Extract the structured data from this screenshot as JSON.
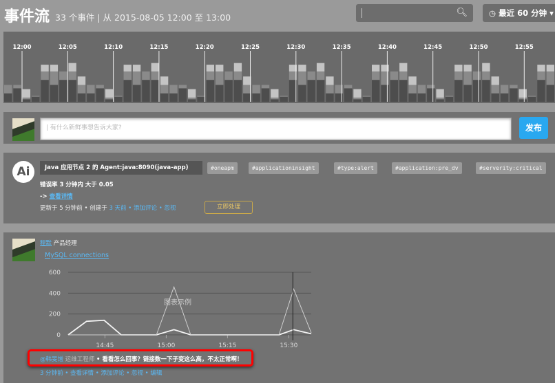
{
  "header": {
    "title": "事件流",
    "subtitle": "33 个事件 | 从 2015-08-05 12:00 至 13:00",
    "search_placeholder": "",
    "search_icon": "search-icon",
    "time_range": "最近 60 分钟"
  },
  "timeline": {
    "labels": [
      "12:00",
      "12:05",
      "12:10",
      "12:15",
      "12:20",
      "12:25",
      "12:30",
      "12:35",
      "12:40",
      "12:45",
      "12:50",
      "12:55"
    ],
    "bar_pattern": [
      [
        5,
        5,
        0
      ],
      [
        8,
        2,
        0
      ],
      [
        1.5,
        1,
        5
      ],
      [
        3,
        0.5,
        0
      ],
      [
        13,
        5,
        4
      ],
      [
        10,
        8,
        4
      ],
      [
        13,
        5,
        0
      ],
      [
        13,
        5,
        5
      ],
      [
        5,
        5,
        5
      ]
    ],
    "bar_count": 60,
    "colors": [
      "#4d4d4d",
      "#8a8a8a",
      "#c4c4c4"
    ]
  },
  "composer": {
    "placeholder": "有什么新鲜事想告诉大家?",
    "publish": "发布"
  },
  "alert": {
    "avatar": "Ai",
    "title": "Java 应用节点 2 的 Agent:java:8090(java-app)",
    "tags": [
      "#oneapm",
      "#applicationinsight",
      "#type:alert",
      "#application:pre_dv",
      "#serverity:critical"
    ],
    "message": "错误率 3 分钟内 大于 0.05",
    "arrow": "->",
    "details": "查看详情",
    "meta_prefix": "更新于 5 分钟前 • 创建于",
    "meta_created": "3 天前",
    "meta_comment": "添加评论",
    "meta_ignore": "忽视",
    "sep": "•",
    "handle": "立即处理"
  },
  "post": {
    "author": "程默",
    "role": "产品经理",
    "chart_link": "MySQL connections",
    "comment_user": "@韩旻馐",
    "comment_role": "运维工程师",
    "comment_text": "• 看看怎么回事？链接数一下子变这么高，不太正常啊！",
    "actions": [
      "3 分钟前",
      "查看详情",
      "添加评论",
      "忽视",
      "编辑"
    ],
    "sep": "•"
  },
  "chart_data": {
    "type": "line",
    "title": "",
    "legend": "图表示例",
    "xlabel": "",
    "ylabel": "",
    "ylim": [
      0,
      600
    ],
    "yticks": [
      0,
      200,
      400,
      600
    ],
    "xticks": [
      "14:45",
      "15:00",
      "15:15",
      "15:30"
    ],
    "xlim_minutes": [
      -9,
      50.5
    ],
    "series": [
      {
        "name": "series-1",
        "x_minutes": [
          -9,
          -4.5,
          -0.2,
          4,
          12.6,
          16.9,
          21,
          42.6,
          46.2,
          50.5
        ],
        "values": [
          0,
          130,
          140,
          0,
          0,
          50,
          0,
          0,
          50,
          10
        ]
      },
      {
        "name": "series-2",
        "x_minutes": [
          -9,
          12.6,
          16.9,
          21,
          42.6,
          46.2,
          50.5
        ],
        "values": [
          0,
          0,
          460,
          0,
          0,
          440,
          20
        ]
      }
    ],
    "cursor_minute": 46
  }
}
